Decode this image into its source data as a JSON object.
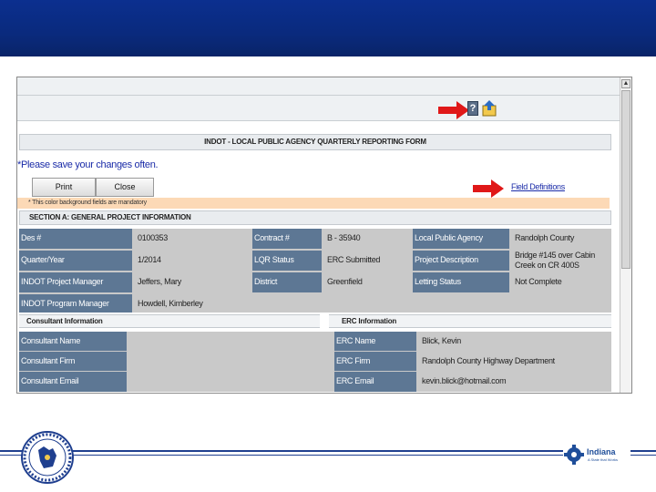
{
  "form": {
    "title": "INDOT - LOCAL PUBLIC AGENCY QUARTERLY REPORTING FORM",
    "save_note": "*Please save your changes often.",
    "print_label": "Print",
    "close_label": "Close",
    "field_definitions_link": "Field Definitions",
    "mandatory_note": "* This color background fields are mandatory",
    "section_a_title": "SECTION A: GENERAL PROJECT INFORMATION"
  },
  "general": {
    "des_label": "Des #",
    "des_value": "0100353",
    "contract_label": "Contract #",
    "contract_value": "B - 35940",
    "lpa_label": "Local Public Agency",
    "lpa_value": "Randolph County",
    "quarter_label": "Quarter/Year",
    "quarter_value": "1/2014",
    "lqr_label": "LQR Status",
    "lqr_value": "ERC Submitted",
    "project_desc_label": "Project Description",
    "project_desc_value_line1": "Bridge #145 over Cabin",
    "project_desc_value_line2": "Creek on CR 400S",
    "pm_label": "INDOT Project Manager",
    "pm_value": "Jeffers, Mary",
    "district_label": "District",
    "district_value": "Greenfield",
    "letting_label": "Letting Status",
    "letting_value": "Not Complete",
    "program_mgr_label": "INDOT Program Manager",
    "program_mgr_value": "Howdell, Kimberley"
  },
  "consultant": {
    "header": "Consultant Information",
    "name_label": "Consultant Name",
    "name_value": "",
    "firm_label": "Consultant Firm",
    "firm_value": "",
    "email_label": "Consultant Email",
    "email_value": ""
  },
  "erc": {
    "header": "ERC Information",
    "name_label": "ERC Name",
    "name_value": "Blick, Kevin",
    "firm_label": "ERC Firm",
    "firm_value": "Randolph County Highway Department",
    "email_label": "ERC Email",
    "email_value": "kevin.blick@hotmail.com"
  },
  "footer": {
    "indiana_word": "Indiana",
    "indiana_tagline": "A State that Works"
  },
  "colors": {
    "banner": "#0a2a7d",
    "label_cell": "#5d7794",
    "value_cell": "#c9c9c9",
    "mandatory_bar": "#fcd9b6",
    "link": "#1b2ca8",
    "arrow": "#e01818"
  },
  "icons": [
    "help-icon",
    "export-icon",
    "red-arrow-icon",
    "state-seal-logo",
    "indiana-gear-logo"
  ]
}
